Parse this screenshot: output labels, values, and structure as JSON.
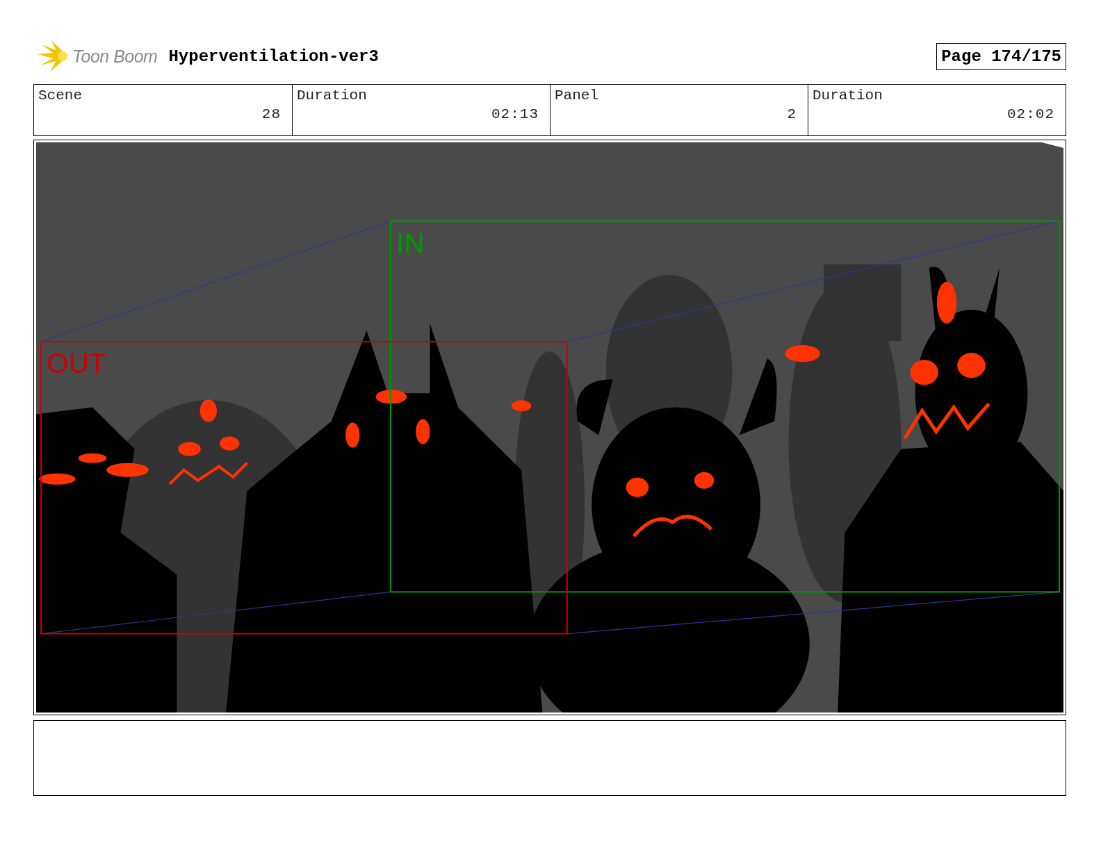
{
  "header": {
    "logo_text": "Toon Boom",
    "project_title": "Hyperventilation-ver3",
    "page": "Page 174/175"
  },
  "info": [
    {
      "label": "Scene",
      "value": "28"
    },
    {
      "label": "Duration",
      "value": "02:13"
    },
    {
      "label": "Panel",
      "value": "2"
    },
    {
      "label": "Duration",
      "value": "02:02"
    }
  ],
  "panel": {
    "frames": [
      {
        "kind": "in",
        "label": "IN",
        "color": "#009900"
      },
      {
        "kind": "out",
        "label": "OUT",
        "color": "#cc0000"
      }
    ]
  }
}
